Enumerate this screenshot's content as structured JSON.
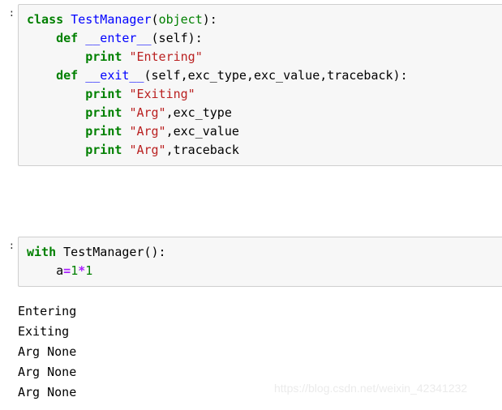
{
  "notebook": {
    "cells": [
      {
        "id": "cell-1",
        "prompt": ":",
        "lines": [
          [
            {
              "t": "class",
              "c": "kw"
            },
            {
              "t": " ",
              "c": "plain"
            },
            {
              "t": "TestManager",
              "c": "cls"
            },
            {
              "t": "(",
              "c": "punct"
            },
            {
              "t": "object",
              "c": "builtin"
            },
            {
              "t": "):",
              "c": "punct"
            }
          ],
          [
            {
              "t": "    ",
              "c": "plain"
            },
            {
              "t": "def",
              "c": "kw"
            },
            {
              "t": " ",
              "c": "plain"
            },
            {
              "t": "__enter__",
              "c": "fn"
            },
            {
              "t": "(self):",
              "c": "punct"
            }
          ],
          [
            {
              "t": "        ",
              "c": "plain"
            },
            {
              "t": "print",
              "c": "kw"
            },
            {
              "t": " ",
              "c": "plain"
            },
            {
              "t": "\"Entering\"",
              "c": "str"
            }
          ],
          [
            {
              "t": "    ",
              "c": "plain"
            },
            {
              "t": "def",
              "c": "kw"
            },
            {
              "t": " ",
              "c": "plain"
            },
            {
              "t": "__exit__",
              "c": "fn"
            },
            {
              "t": "(self,exc_type,exc_value,traceback):",
              "c": "punct"
            }
          ],
          [
            {
              "t": "        ",
              "c": "plain"
            },
            {
              "t": "print",
              "c": "kw"
            },
            {
              "t": " ",
              "c": "plain"
            },
            {
              "t": "\"Exiting\"",
              "c": "str"
            }
          ],
          [
            {
              "t": "        ",
              "c": "plain"
            },
            {
              "t": "print",
              "c": "kw"
            },
            {
              "t": " ",
              "c": "plain"
            },
            {
              "t": "\"Arg\"",
              "c": "str"
            },
            {
              "t": ",exc_type",
              "c": "plain"
            }
          ],
          [
            {
              "t": "        ",
              "c": "plain"
            },
            {
              "t": "print",
              "c": "kw"
            },
            {
              "t": " ",
              "c": "plain"
            },
            {
              "t": "\"Arg\"",
              "c": "str"
            },
            {
              "t": ",exc_value",
              "c": "plain"
            }
          ],
          [
            {
              "t": "        ",
              "c": "plain"
            },
            {
              "t": "print",
              "c": "kw"
            },
            {
              "t": " ",
              "c": "plain"
            },
            {
              "t": "\"Arg\"",
              "c": "str"
            },
            {
              "t": ",traceback",
              "c": "plain"
            }
          ]
        ]
      },
      {
        "id": "cell-2",
        "prompt": ":",
        "lines": [
          [
            {
              "t": "with",
              "c": "kw"
            },
            {
              "t": " ",
              "c": "plain"
            },
            {
              "t": "TestManager",
              "c": "plain"
            },
            {
              "t": "():",
              "c": "punct"
            }
          ],
          [
            {
              "t": "    a",
              "c": "plain"
            },
            {
              "t": "=",
              "c": "op"
            },
            {
              "t": "1",
              "c": "num"
            },
            {
              "t": "*",
              "c": "op"
            },
            {
              "t": "1",
              "c": "num"
            }
          ]
        ]
      }
    ],
    "output": {
      "lines": [
        "Entering",
        "Exiting",
        "Arg None",
        "Arg None",
        "Arg None"
      ]
    },
    "watermark": "https://blog.csdn.net/weixin_42341232",
    "colors": {
      "cell_background": "#f7f7f7",
      "cell_border": "#cfcfcf",
      "keyword": "#008000",
      "class_name": "#0000ff",
      "string": "#ba2121",
      "number": "#008000",
      "operator": "#aa22ff",
      "text": "#000000",
      "watermark": "#ebebeb",
      "page_background": "#ffffff"
    }
  }
}
